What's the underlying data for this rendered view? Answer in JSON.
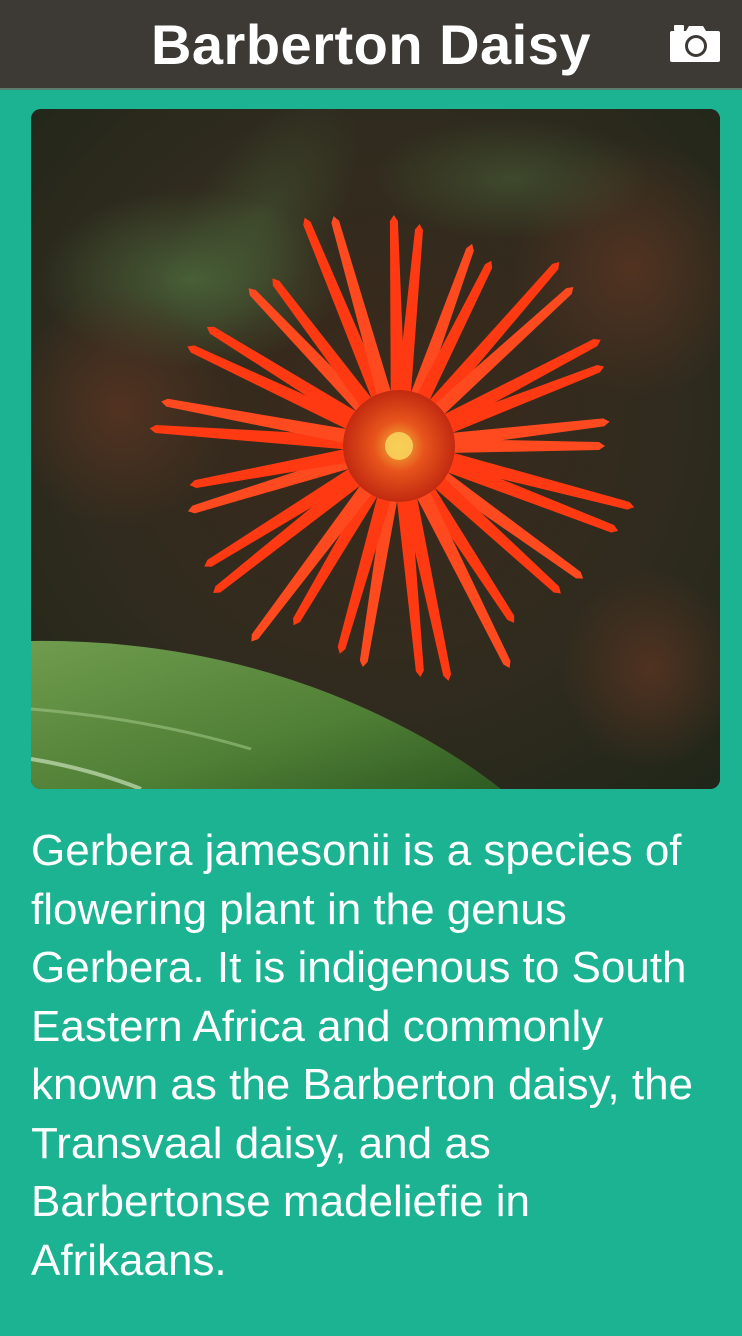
{
  "header": {
    "title": "Barberton Daisy",
    "camera_icon": "camera-icon"
  },
  "photo": {
    "subject": "flower-photo"
  },
  "description": {
    "text": "Gerbera jamesonii is a species of flowering plant in the genus Gerbera. It is indigenous to South Eastern Africa and commonly known as the Barberton daisy, the Transvaal daisy, and as Barbertonse madeliefie in Afrikaans."
  },
  "colors": {
    "background": "#1bb392",
    "header": "#3d3a35",
    "text": "#ffffff",
    "petal": "#ff3a12"
  }
}
